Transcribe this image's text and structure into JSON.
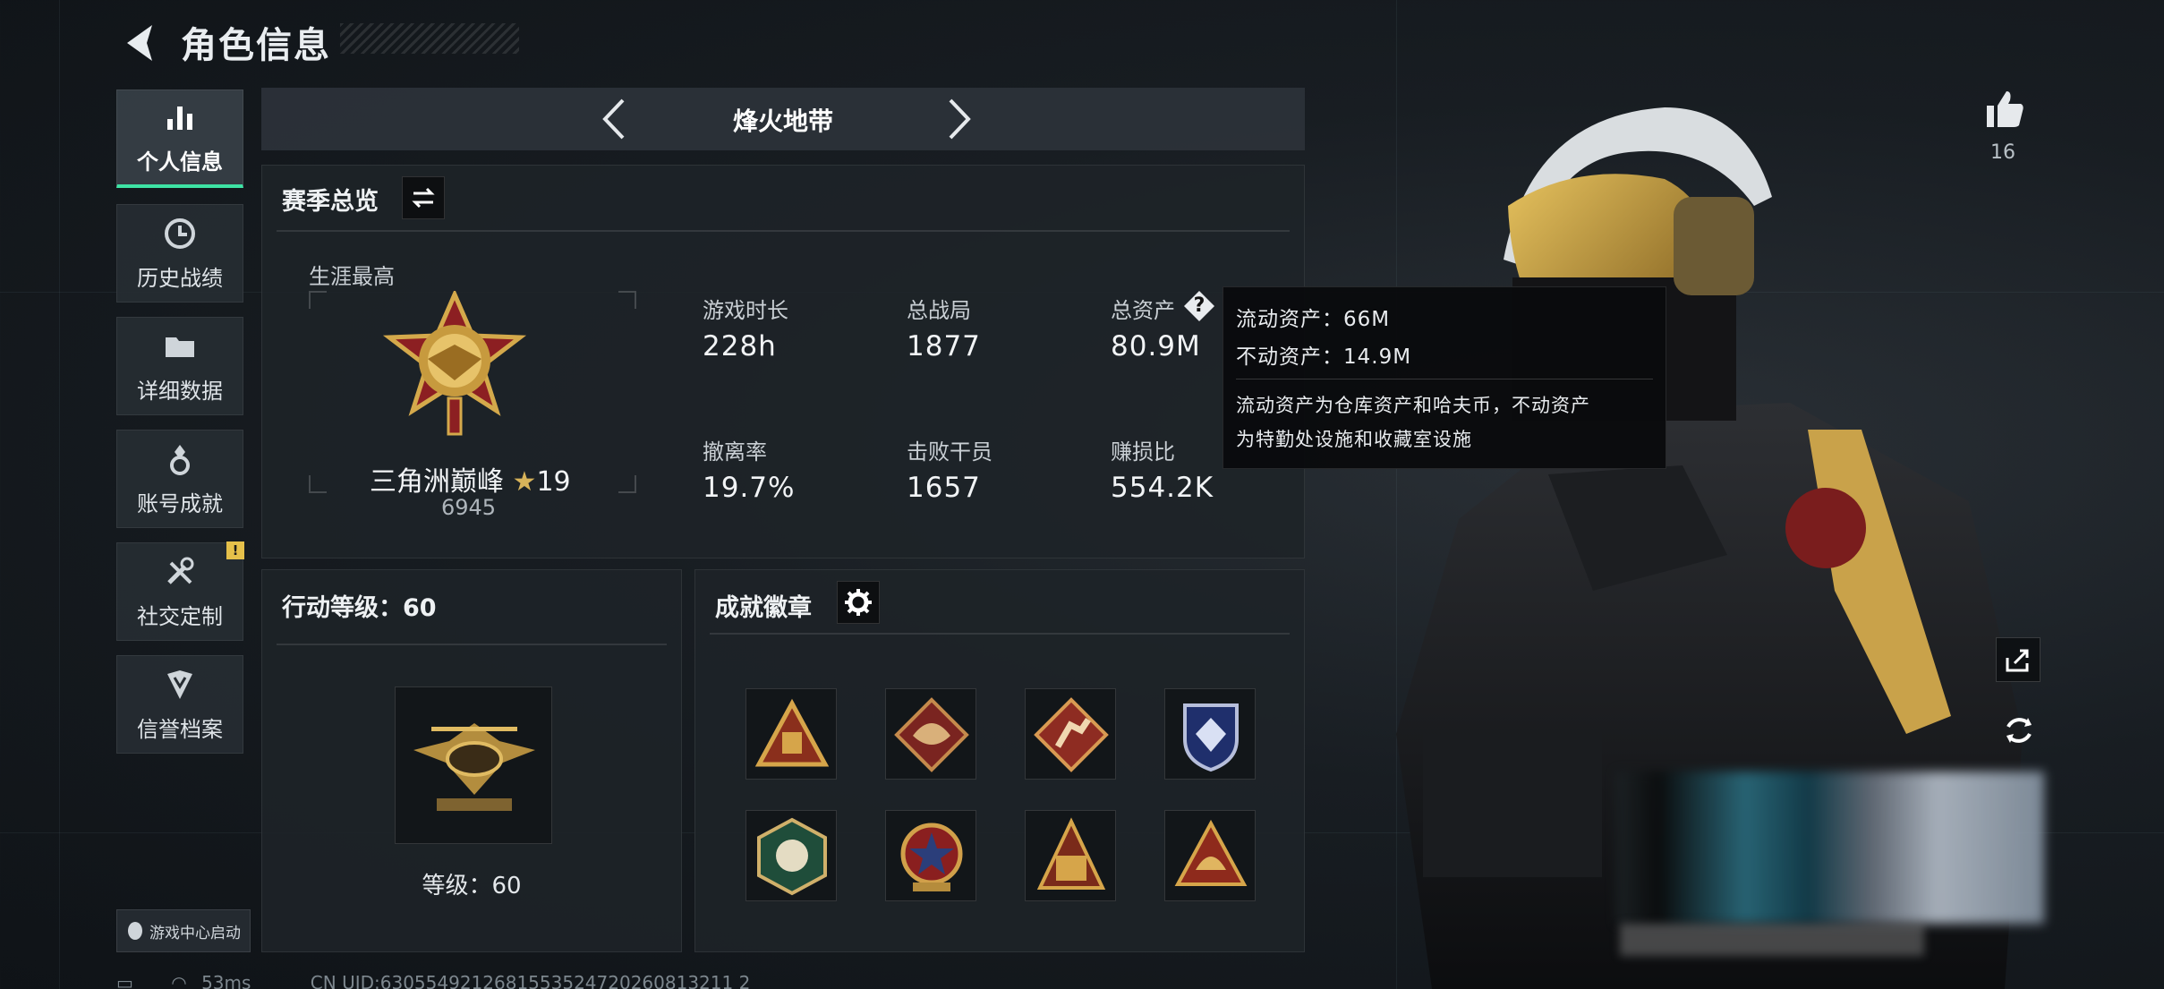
{
  "header": {
    "title": "角色信息"
  },
  "nav": {
    "items": [
      {
        "label": "个人信息",
        "active": true,
        "icon": "bar-chart-icon"
      },
      {
        "label": "历史战绩",
        "active": false,
        "icon": "clock-icon"
      },
      {
        "label": "详细数据",
        "active": false,
        "icon": "folder-icon"
      },
      {
        "label": "账号成就",
        "active": false,
        "icon": "medal-icon"
      },
      {
        "label": "社交定制",
        "active": false,
        "icon": "tools-icon",
        "badge": "!"
      },
      {
        "label": "信誉档案",
        "active": false,
        "icon": "shield-icon"
      }
    ],
    "launch_label": "游戏中心启动"
  },
  "mode": {
    "name": "烽火地带"
  },
  "season": {
    "title": "赛季总览",
    "career_label": "生涯最高",
    "rank_name": "三角洲巅峰",
    "rank_stars": "19",
    "rank_points": "6945",
    "stats": [
      {
        "label": "游戏时长",
        "value": "228h"
      },
      {
        "label": "总战局",
        "value": "1877"
      },
      {
        "label": "总资产",
        "value": "80.9M"
      },
      {
        "label": "撤离率",
        "value": "19.7%"
      },
      {
        "label": "击败干员",
        "value": "1657"
      },
      {
        "label": "赚损比",
        "value": "554.2K"
      }
    ]
  },
  "tooltip": {
    "line1": "流动资产：66M",
    "line2": "不动资产：14.9M",
    "desc1": "流动资产为仓库资产和哈夫币，不动资产",
    "desc2": "为特勤处设施和收藏室设施"
  },
  "action_level": {
    "title": "行动等级：60",
    "level_text": "等级：60"
  },
  "badges": {
    "title": "成就徽章",
    "items": [
      "triangle-crate-badge",
      "dragon-badge",
      "runner-badge",
      "shield-badge",
      "hexagon-climber-badge",
      "star-wreath-badge",
      "pyramid-badge",
      "helmet-badge"
    ]
  },
  "likes": {
    "count": "16"
  },
  "status": {
    "ping": "53ms",
    "uid": "CN UID:6305549212681553524720260813211 2"
  },
  "colors": {
    "accent": "#3ee3a4",
    "gold": "#c9a24a",
    "warning": "#e5c04a"
  }
}
